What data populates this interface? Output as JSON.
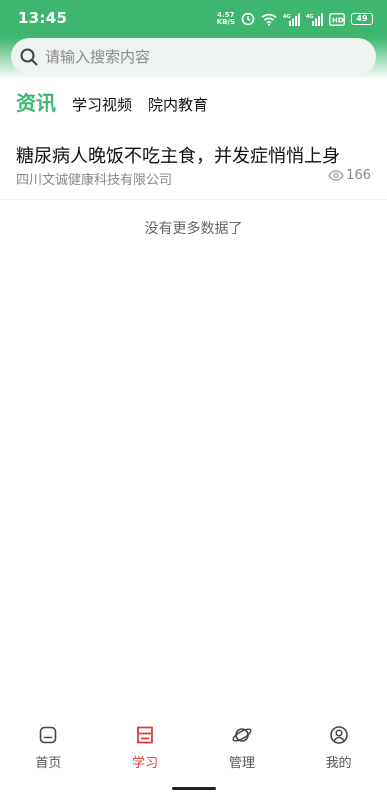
{
  "status_bar": {
    "time": "13:45",
    "net_speed_value": "4.57",
    "net_speed_unit": "KB/S",
    "battery": "49",
    "icons": [
      "alarm-icon",
      "wifi-icon",
      "signal-4g-icon",
      "signal-icon",
      "hd-icon",
      "battery-icon"
    ]
  },
  "search": {
    "placeholder": "请输入搜索内容",
    "value": ""
  },
  "tabs": [
    {
      "label": "资讯",
      "active": true
    },
    {
      "label": "学习视频",
      "active": false
    },
    {
      "label": "院内教育",
      "active": false
    }
  ],
  "articles": [
    {
      "title": "糖尿病人晚饭不吃主食，并发症悄悄上身",
      "source": "四川文诚健康科技有限公司",
      "views": "166"
    }
  ],
  "list_footer": "没有更多数据了",
  "bottom_nav": [
    {
      "label": "首页",
      "icon": "home-icon",
      "active": false
    },
    {
      "label": "学习",
      "icon": "study-icon",
      "active": true
    },
    {
      "label": "管理",
      "icon": "planet-icon",
      "active": false
    },
    {
      "label": "我的",
      "icon": "profile-icon",
      "active": false
    }
  ],
  "colors": {
    "brand_green": "#3fb670",
    "active_red": "#e53935"
  }
}
